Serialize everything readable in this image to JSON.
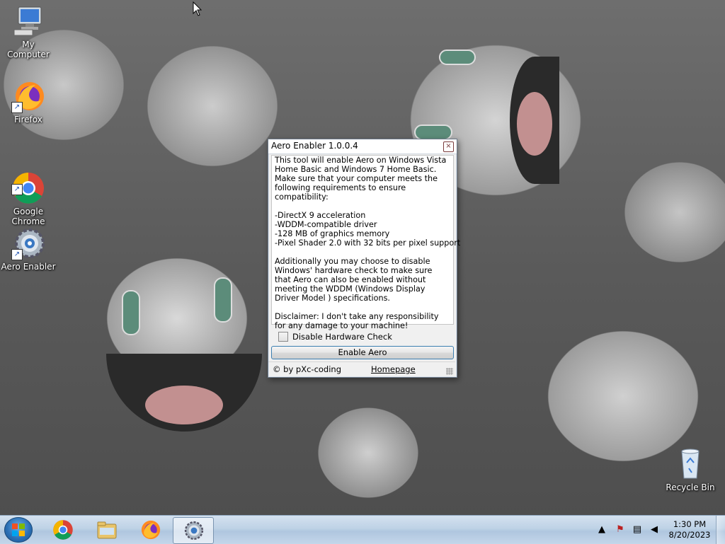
{
  "desktop": {
    "icons": [
      {
        "label": "My Computer"
      },
      {
        "label": "Firefox"
      },
      {
        "label": "Google\nChrome"
      },
      {
        "label": "Aero Enabler"
      },
      {
        "label": "Recycle Bin"
      }
    ]
  },
  "dialog": {
    "title": "Aero Enabler 1.0.0.4",
    "close_glyph": "×",
    "intro": "This tool will enable Aero on Windows Vista Home Basic and Windows 7 Home Basic. Make sure that your computer meets the following requirements to ensure compatibility:",
    "requirements": [
      "-DirectX 9 acceleration",
      "-WDDM-compatible driver",
      "-128 MB of graphics memory",
      "-Pixel Shader 2.0 with 32 bits per pixel support"
    ],
    "additional": "Additionally you may choose to disable Windows' hardware check to make sure that Aero can also be enabled without meeting the WDDM (Windows Display Driver Model ) specifications.",
    "disclaimer": "Disclaimer: I don't take any responsibility for any damage to your machine!",
    "checkbox_label": "Disable Hardware Check",
    "checkbox_checked": false,
    "button_label": "Enable Aero",
    "credit": "© by pXc-coding",
    "link": "Homepage"
  },
  "taskbar": {
    "apps": [
      "start-icon",
      "chrome-icon",
      "explorer-icon",
      "firefox-icon",
      "aero-enabler-icon"
    ],
    "time": "1:30 PM",
    "date": "8/20/2023",
    "tray_icons": [
      "show-hidden-icons",
      "action-center-icon",
      "network-icon",
      "volume-icon"
    ]
  },
  "colors": {
    "accent": "#3c7fb1",
    "taskbar": "#bed2e6"
  }
}
